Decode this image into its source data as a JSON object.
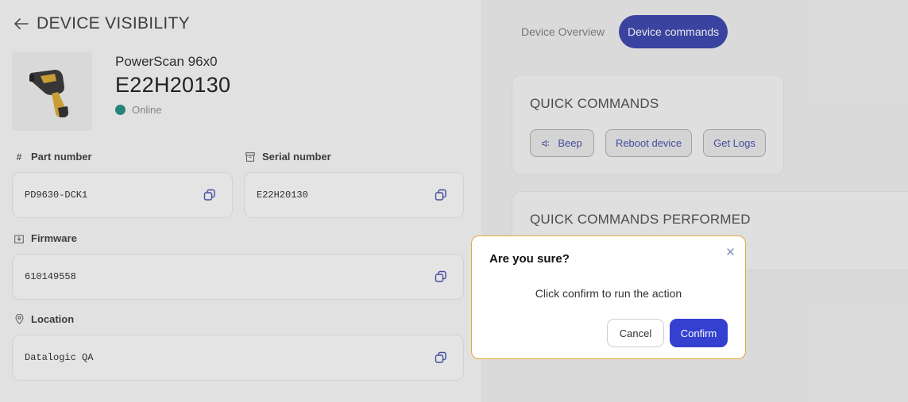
{
  "header": {
    "title": "DEVICE VISIBILITY",
    "back_icon": "arrow-left-icon"
  },
  "device": {
    "image_icon": "barcode-scanner-icon",
    "model": "PowerScan 96x0",
    "id": "E22H20130",
    "status": "Online",
    "status_color": "#17867a"
  },
  "fields": {
    "part_number": {
      "label": "Part number",
      "icon": "hash-icon",
      "value": "PD9630-DCK1"
    },
    "serial_number": {
      "label": "Serial number",
      "icon": "archive-icon",
      "value": "E22H20130"
    },
    "firmware": {
      "label": "Firmware",
      "icon": "download-box-icon",
      "value": "610149558"
    },
    "location": {
      "label": "Location",
      "icon": "map-pin-icon",
      "value": "Datalogic QA"
    }
  },
  "tabs": [
    {
      "label": "Device Overview",
      "active": false
    },
    {
      "label": "Device commands",
      "active": true
    }
  ],
  "quick_commands": {
    "title": "QUICK COMMANDS",
    "buttons": [
      {
        "label": "Beep",
        "icon": "speaker-icon"
      },
      {
        "label": "Reboot device"
      },
      {
        "label": "Get Logs"
      }
    ]
  },
  "performed": {
    "title": "QUICK COMMANDS PERFORMED"
  },
  "modal": {
    "title": "Are you sure?",
    "message": "Click confirm to run the action",
    "cancel_label": "Cancel",
    "confirm_label": "Confirm"
  },
  "colors": {
    "accent": "#2f3aa8",
    "confirm": "#3340d0",
    "modal_border": "#e7a93a",
    "command_text": "#3a44a5"
  }
}
